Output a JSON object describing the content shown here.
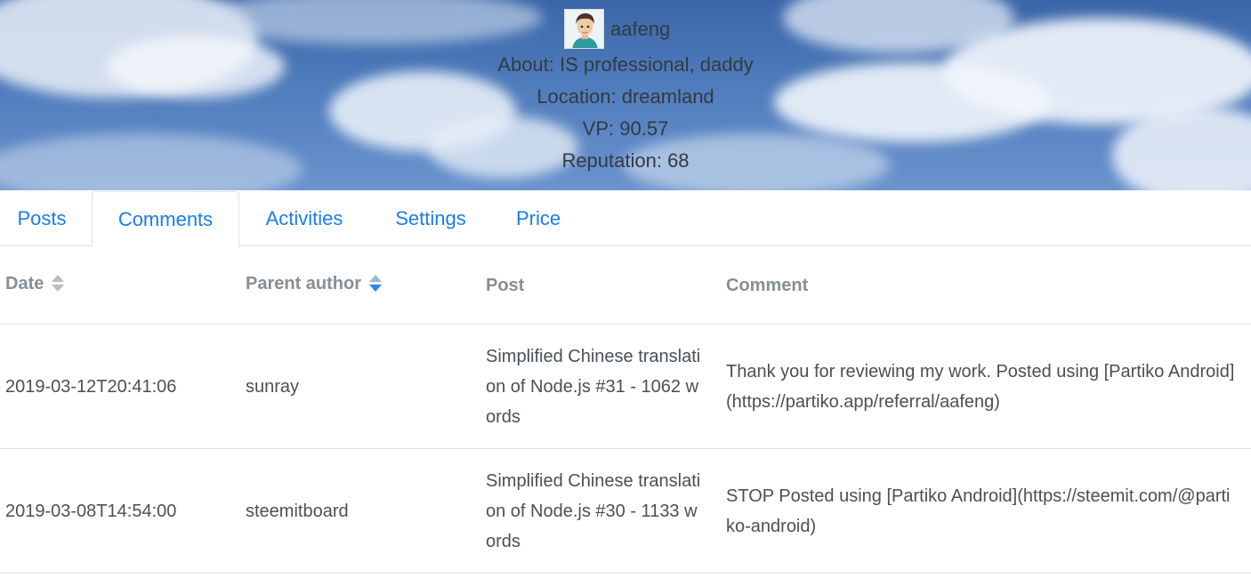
{
  "profile": {
    "username": "aafeng",
    "about": "About: IS professional, daddy",
    "location": "Location: dreamland",
    "vp": "VP: 90.57",
    "reputation": "Reputation: 68"
  },
  "tabs": [
    {
      "label": "Posts",
      "active": false
    },
    {
      "label": "Comments",
      "active": true
    },
    {
      "label": "Activities",
      "active": false
    },
    {
      "label": "Settings",
      "active": false
    },
    {
      "label": "Price",
      "active": false
    }
  ],
  "table": {
    "columns": [
      "Date",
      "Parent author",
      "Post",
      "Comment"
    ],
    "rows": [
      {
        "date": "2019-03-12T20:41:06",
        "parent_author": "sunray",
        "post": "Simplified Chinese translation of Node.js #31 - 1062 words",
        "comment": "Thank you for reviewing my work. Posted using [Partiko Android](https://partiko.app/referral/aafeng)"
      },
      {
        "date": "2019-03-08T14:54:00",
        "parent_author": "steemitboard",
        "post": "Simplified Chinese translation of Node.js #30 - 1133 words",
        "comment": "STOP Posted using [Partiko Android](https://steemit.com/@partiko-android)"
      }
    ]
  },
  "colors": {
    "link": "#1a7cf0",
    "header_text": "#868e96",
    "body_text": "#495057",
    "sky": "#4f7cbc"
  }
}
